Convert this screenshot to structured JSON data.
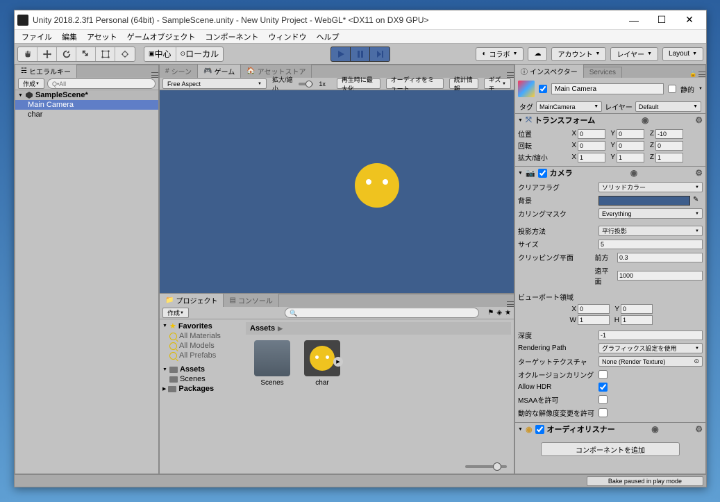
{
  "titlebar": {
    "text": "Unity 2018.2.3f1 Personal (64bit) - SampleScene.unity - New Unity Project - WebGL* <DX11 on DX9 GPU>"
  },
  "menu": {
    "items": [
      "ファイル",
      "編集",
      "アセット",
      "ゲームオブジェクト",
      "コンポーネント",
      "ウィンドウ",
      "ヘルプ"
    ]
  },
  "toolbar": {
    "pivot_center": "中心",
    "pivot_local": "ローカル",
    "collab": "コラボ",
    "account": "アカウント",
    "layers": "レイヤー",
    "layout": "Layout"
  },
  "hierarchy": {
    "tab": "ヒエラルキー",
    "create": "作成",
    "search_placeholder": "Q•All",
    "scene": "SampleScene*",
    "items": [
      "Main Camera",
      "char"
    ]
  },
  "scene_tabs": {
    "scene": "シーン",
    "game": "ゲーム",
    "asset_store": "アセットストア"
  },
  "gamebar": {
    "aspect": "Free Aspect",
    "scale_label": "拡大/縮小",
    "scale_value": "1x",
    "maximize": "再生時に最大化",
    "mute": "オーディオをミュート",
    "stats": "統計情報",
    "gizmo": "ギズモ"
  },
  "project": {
    "tab_project": "プロジェクト",
    "tab_console": "コンソール",
    "create": "作成",
    "favorites": "Favorites",
    "fav_items": [
      "All Materials",
      "All Models",
      "All Prefabs"
    ],
    "assets": "Assets",
    "subfolders": [
      "Scenes"
    ],
    "packages": "Packages",
    "breadcrumb": "Assets",
    "grid": {
      "folder_scenes": "Scenes",
      "item_char": "char"
    }
  },
  "inspector": {
    "tab_inspector": "インスペクター",
    "tab_services": "Services",
    "object_name": "Main Camera",
    "static_label": "静的",
    "tag_label": "タグ",
    "tag_value": "MainCamera",
    "layer_label": "レイヤー",
    "layer_value": "Default",
    "transform": {
      "title": "トランスフォーム",
      "position": "位置",
      "pos": {
        "x": "0",
        "y": "0",
        "z": "-10"
      },
      "rotation": "回転",
      "rot": {
        "x": "0",
        "y": "0",
        "z": "0"
      },
      "scale": "拡大/縮小",
      "scl": {
        "x": "1",
        "y": "1",
        "z": "1"
      }
    },
    "camera": {
      "title": "カメラ",
      "clear_flags_label": "クリアフラグ",
      "clear_flags": "ソリッドカラー",
      "background_label": "背景",
      "culling_label": "カリングマスク",
      "culling": "Everything",
      "projection_label": "投影方法",
      "projection": "平行投影",
      "size_label": "サイズ",
      "size": "5",
      "clipping_label": "クリッピング平面",
      "near_label": "前方",
      "near": "0.3",
      "far_label": "遠平面",
      "far": "1000",
      "viewport_label": "ビューポート領域",
      "vp_x": "0",
      "vp_y": "0",
      "vp_w": "1",
      "vp_h": "1",
      "depth_label": "深度",
      "depth": "-1",
      "rendering_path_label": "Rendering Path",
      "rendering_path": "グラフィックス設定を使用",
      "target_texture_label": "ターゲットテクスチャ",
      "target_texture": "None (Render Texture)",
      "occlusion_label": "オクルージョンカリング",
      "hdr_label": "Allow HDR",
      "msaa_label": "MSAAを許可",
      "dynamic_label": "動的な解像度変更を許可"
    },
    "audio": {
      "title": "オーディオリスナー"
    },
    "add_component": "コンポーネントを追加"
  },
  "statusbar": {
    "text": "Bake paused in play mode"
  }
}
